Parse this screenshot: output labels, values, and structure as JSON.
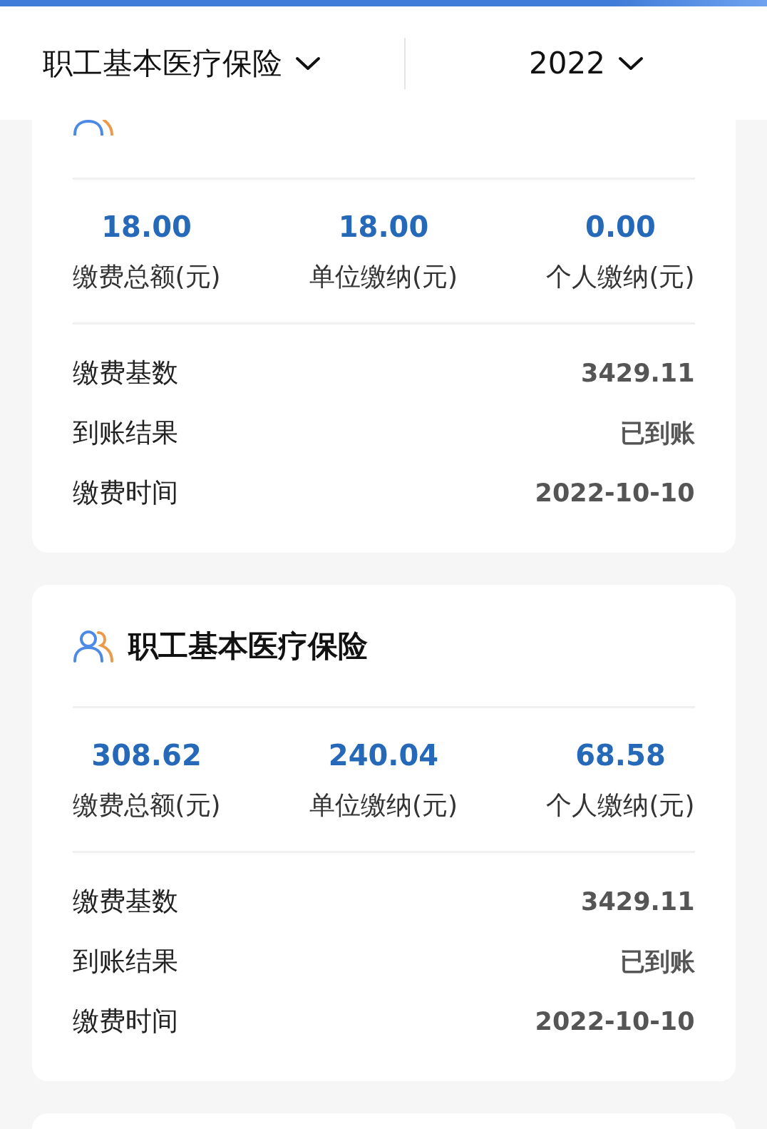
{
  "header": {
    "insurance_filter": {
      "label": "职工基本医疗保险"
    },
    "year_filter": {
      "label": "2022"
    }
  },
  "records": [
    {
      "stats": [
        {
          "value": "18.00",
          "label": "缴费总额(元)"
        },
        {
          "value": "18.00",
          "label": "单位缴纳(元)"
        },
        {
          "value": "0.00",
          "label": "个人缴纳(元)"
        }
      ],
      "details": [
        {
          "label": "缴费基数",
          "value": "3429.11"
        },
        {
          "label": "到账结果",
          "value": "已到账"
        },
        {
          "label": "缴费时间",
          "value": "2022-10-10"
        }
      ]
    },
    {
      "title": "职工基本医疗保险",
      "stats": [
        {
          "value": "308.62",
          "label": "缴费总额(元)"
        },
        {
          "value": "240.04",
          "label": "单位缴纳(元)"
        },
        {
          "value": "68.58",
          "label": "个人缴纳(元)"
        }
      ],
      "details": [
        {
          "label": "缴费基数",
          "value": "3429.11"
        },
        {
          "label": "到账结果",
          "value": "已到账"
        },
        {
          "label": "缴费时间",
          "value": "2022-10-10"
        }
      ]
    }
  ]
}
